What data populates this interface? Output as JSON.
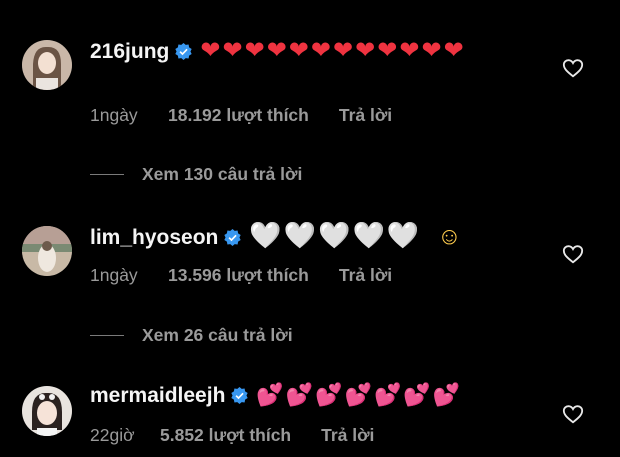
{
  "comments": [
    {
      "username": "216jung",
      "emojis": "❤❤❤❤❤❤❤❤❤❤❤❤",
      "emoji_type": "red-heart",
      "time": "1ngày",
      "likes": "18.192 lượt thích",
      "reply_label": "Trả lời",
      "view_replies": "Xem 130 câu trả lời"
    },
    {
      "username": "lim_hyoseon",
      "emojis": "🤍🤍🤍🤍🤍",
      "emoji_type": "white-heart",
      "extra_emoji": "☺",
      "time": "1ngày",
      "likes": "13.596 lượt thích",
      "reply_label": "Trả lời",
      "view_replies": "Xem 26 câu trả lời"
    },
    {
      "username": "mermaidleejh",
      "emojis": "💕💕💕💕💕💕💕",
      "emoji_type": "two-hearts",
      "time": "22giờ",
      "likes": "5.852 lượt thích",
      "reply_label": "Trả lời"
    }
  ],
  "colors": {
    "background": "#000000",
    "verified_badge": "#3897f0",
    "muted_text": "#9a9a9a",
    "red_heart": "#ef3340",
    "pink_heart": "#ff4fb3"
  }
}
